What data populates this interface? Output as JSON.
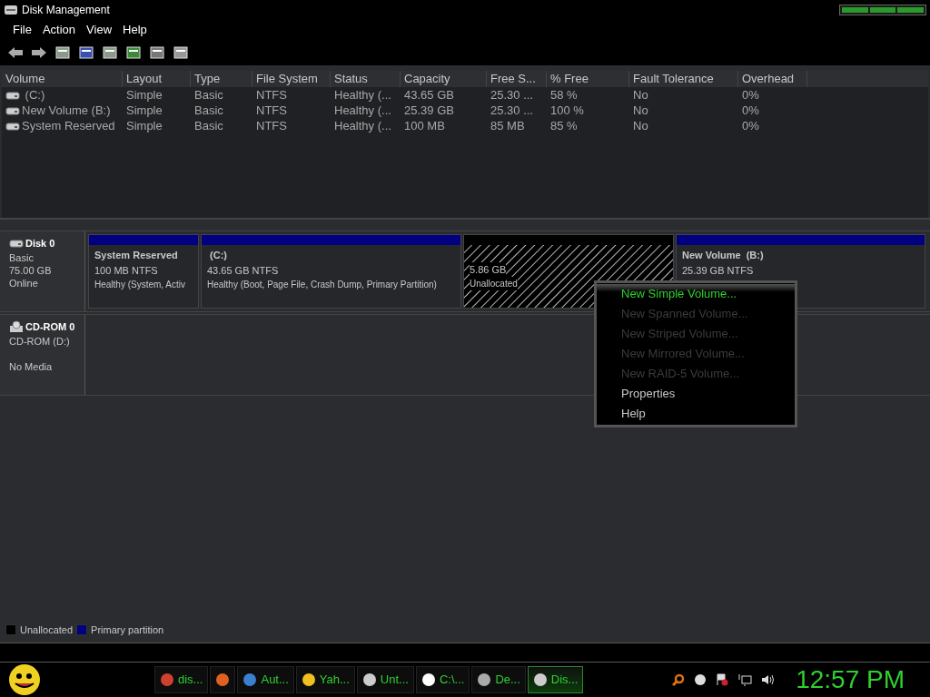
{
  "window": {
    "title": "Disk Management"
  },
  "menu": [
    "File",
    "Action",
    "View",
    "Help"
  ],
  "table": {
    "columns": [
      "Volume",
      "Layout",
      "Type",
      "File System",
      "Status",
      "Capacity",
      "Free S...",
      "% Free",
      "Fault Tolerance",
      "Overhead"
    ],
    "rows": [
      {
        "cells": [
          " (C:)",
          "Simple",
          "Basic",
          "NTFS",
          "Healthy (...",
          "43.65 GB",
          "25.30 ...",
          "58 %",
          "No",
          "0%"
        ]
      },
      {
        "cells": [
          "New Volume (B:)",
          "Simple",
          "Basic",
          "NTFS",
          "Healthy (...",
          "25.39 GB",
          "25.30 ...",
          "100 %",
          "No",
          "0%"
        ]
      },
      {
        "cells": [
          "System Reserved",
          "Simple",
          "Basic",
          "NTFS",
          "Healthy (...",
          "100 MB",
          "85 MB",
          "85 %",
          "No",
          "0%"
        ]
      }
    ]
  },
  "disks": [
    {
      "kind": "disk",
      "name": "Disk 0",
      "lines": [
        "Basic",
        "75.00 GB",
        "Online"
      ],
      "partitions": [
        {
          "kind": "primary",
          "name": "System Reserved",
          "size": "100 MB NTFS",
          "status": "Healthy (System, Activ"
        },
        {
          "kind": "primary",
          "name": " (C:)",
          "size": "43.65 GB NTFS",
          "status": "Healthy (Boot, Page File, Crash Dump, Primary Partition)"
        },
        {
          "kind": "unallocated",
          "size": "5.86 GB",
          "status": "Unallocated"
        },
        {
          "kind": "primary",
          "name": "New Volume  (B:)",
          "size": "25.39 GB NTFS"
        }
      ]
    },
    {
      "kind": "cdrom",
      "name": "CD-ROM 0",
      "lines": [
        "CD-ROM (D:)",
        "No Media"
      ]
    }
  ],
  "context_menu": [
    {
      "label": "New Simple Volume...",
      "disabled": false,
      "selected": true
    },
    {
      "label": "New Spanned Volume...",
      "disabled": true,
      "selected": false
    },
    {
      "label": "New Striped Volume...",
      "disabled": true,
      "selected": false
    },
    {
      "label": "New Mirrored Volume...",
      "disabled": true,
      "selected": false
    },
    {
      "label": "New RAID-5 Volume...",
      "disabled": true,
      "selected": false
    },
    {
      "label": "Properties",
      "disabled": false,
      "selected": false
    },
    {
      "label": "Help",
      "disabled": false,
      "selected": false
    }
  ],
  "legend": [
    {
      "label": "Unallocated",
      "color": "#000000"
    },
    {
      "label": "Primary partition",
      "color": "#000080"
    }
  ],
  "taskbar": {
    "items": [
      {
        "label": "dis...",
        "selected": false
      },
      {
        "selected": false
      },
      {
        "label": "Aut...",
        "selected": false
      },
      {
        "label": "Yah...",
        "selected": false
      },
      {
        "label": "Unt...",
        "selected": false
      },
      {
        "label": "C:\\...",
        "selected": false
      },
      {
        "label": "De...",
        "selected": false
      },
      {
        "label": "Dis...",
        "selected": true
      }
    ],
    "clock": "12:57 PM"
  }
}
